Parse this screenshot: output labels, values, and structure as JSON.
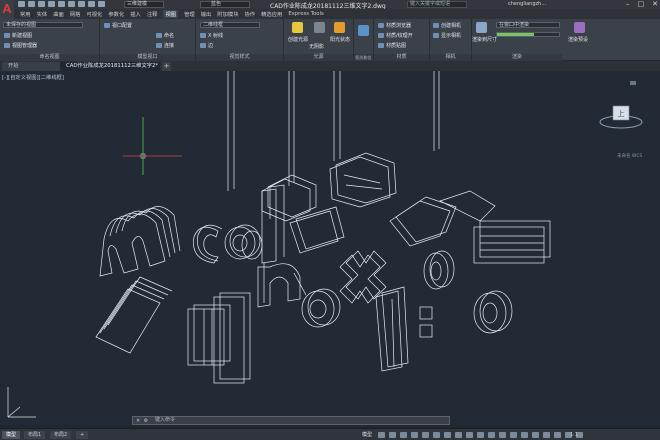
{
  "title_bar": {
    "app_logo": "A",
    "workspace": "三维建模",
    "layer": "蓝色",
    "document_title": "CAD作业陈成龙20181112三维文字2.dwg",
    "search_placeholder": "键入关键字或短语",
    "user": "chengliangzh...",
    "win_controls": [
      "–",
      "□",
      "✕"
    ]
  },
  "menu": {
    "items": [
      "常用",
      "实体",
      "曲面",
      "网格",
      "可视化",
      "参数化",
      "插入",
      "注释",
      "视图",
      "管理",
      "输出",
      "附加模块",
      "协作",
      "精选应用",
      "Express Tools"
    ],
    "active_index": 8
  },
  "ribbon": {
    "groups": [
      {
        "title": "命名视图",
        "buttons": [
          "未保存的视图",
          "新建视图",
          "视图管理器"
        ]
      },
      {
        "title": "模型视口",
        "buttons": [
          "视口配置",
          "命名",
          "连接"
        ]
      },
      {
        "title": "视觉样式",
        "buttons": [
          "二维线框",
          "X 射线",
          "边"
        ]
      },
      {
        "title": "光源",
        "buttons": [
          "创建光源",
          "无阴影",
          "阳光状态"
        ]
      },
      {
        "title": "阳光和位置",
        "buttons": [
          "位置"
        ]
      },
      {
        "title": "材质",
        "buttons": [
          "材质浏览器",
          "材质/纹理开",
          "材质贴图"
        ]
      },
      {
        "title": "相机",
        "buttons": [
          "创建相机",
          "显示相机"
        ]
      },
      {
        "title": "渲染",
        "buttons": [
          "渲染到尺寸",
          "在窗口中渲染",
          "渲染环境"
        ]
      }
    ],
    "render_size_label": "渲染到尺寸",
    "render_window_label": "在窗口中渲染",
    "render_preset_label": "渲染预设",
    "render_progress": 0.6
  },
  "file_tabs": {
    "items": [
      "开始",
      "CAD作业陈成龙20181112三维文字2*"
    ],
    "active_index": 1,
    "add_label": "+"
  },
  "viewport": {
    "label": "[-][自定义视图][二维线框]",
    "viewcube_face": "上",
    "wcs_label": "未命名 WCS"
  },
  "command_line": {
    "placeholder": "键入命令"
  },
  "status_bar": {
    "layout_tabs": [
      "模型",
      "布局1",
      "布局2"
    ],
    "active_tab": 0,
    "add_label": "+",
    "model_label": "模型",
    "scale": "1:1"
  },
  "colors": {
    "background": "#222a35",
    "wire": "#ffffff",
    "crosshair_x": "#d84a4a",
    "crosshair_y": "#4ac84a",
    "accent": "#6f8fb6"
  }
}
